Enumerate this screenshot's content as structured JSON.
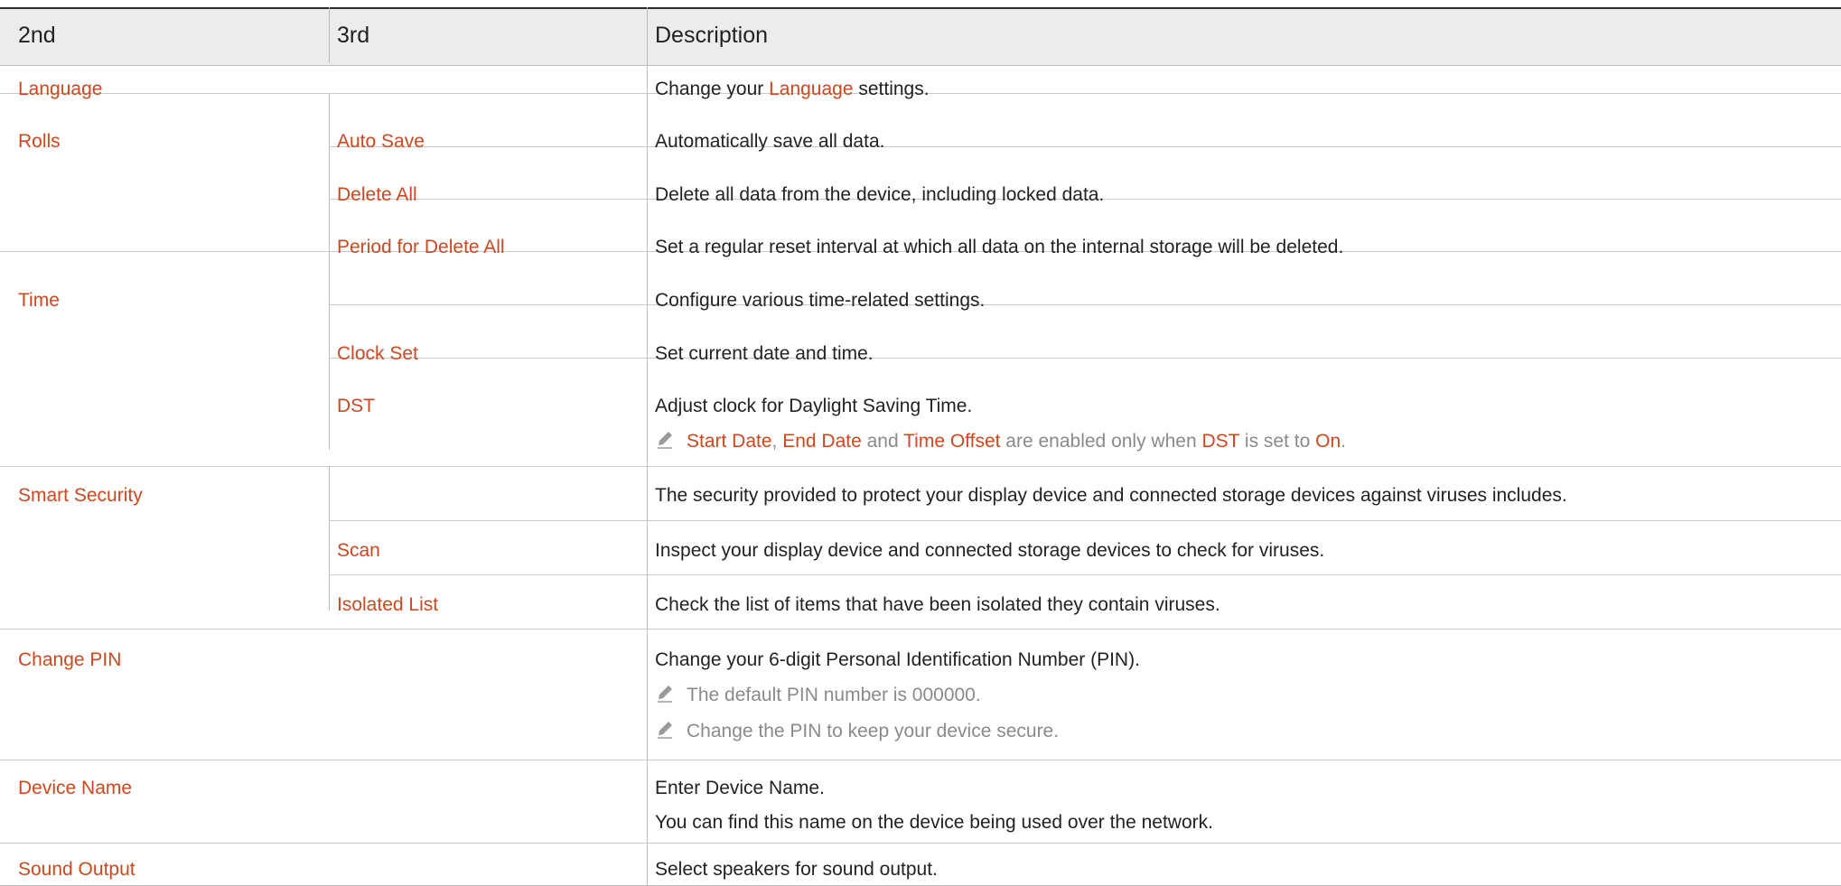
{
  "header": {
    "col1": "2nd",
    "col2": "3rd",
    "col3": "Description"
  },
  "rows": {
    "language": {
      "col1": "Language",
      "desc_prefix": "Change your ",
      "desc_link": "Language",
      "desc_suffix": " settings."
    },
    "rolls": {
      "col1": "Rolls",
      "auto_save": {
        "col2": "Auto Save",
        "desc": "Automatically save all data."
      },
      "delete_all": {
        "col2": "Delete All",
        "desc": "Delete all data from the device, including locked data."
      },
      "period": {
        "col2": "Period for Delete All",
        "desc": "Set a regular reset interval at which all data on the internal storage will be deleted."
      }
    },
    "time": {
      "col1": "Time",
      "desc": "Configure various time-related settings.",
      "clock_set": {
        "col2": "Clock Set",
        "desc": "Set current date and time."
      },
      "dst": {
        "col2": "DST",
        "desc": "Adjust clock for Daylight Saving Time.",
        "note": {
          "t1": "Start Date",
          "t2": ", ",
          "t3": "End Date",
          "t4": " and ",
          "t5": "Time Offset",
          "t6": " are enabled only when ",
          "t7": "DST",
          "t8": " is set to ",
          "t9": "On",
          "t10": "."
        }
      }
    },
    "smart_security": {
      "col1": "Smart Security",
      "desc": "The security provided to protect your display device and connected storage devices against viruses includes.",
      "scan": {
        "col2": "Scan",
        "desc": "Inspect your display device and connected storage devices to check for viruses."
      },
      "isolated": {
        "col2": "Isolated List",
        "desc": "Check the list of items that have been isolated they contain viruses."
      }
    },
    "change_pin": {
      "col1": "Change PIN",
      "desc": "Change your 6-digit Personal Identification Number (PIN).",
      "note1": "The default PIN number is 000000.",
      "note2": "Change the PIN to keep your device secure."
    },
    "device_name": {
      "col1": "Device Name",
      "desc1": "Enter Device Name.",
      "desc2": "You can find this name on the device being used over the network."
    },
    "sound_output": {
      "col1": "Sound Output",
      "desc": "Select speakers for sound output."
    }
  },
  "colors": {
    "accent": "#d2461e",
    "note_grey": "#8a8a8a",
    "header_bg": "#ececec"
  },
  "icons": {
    "note": "pencil-note-icon"
  }
}
